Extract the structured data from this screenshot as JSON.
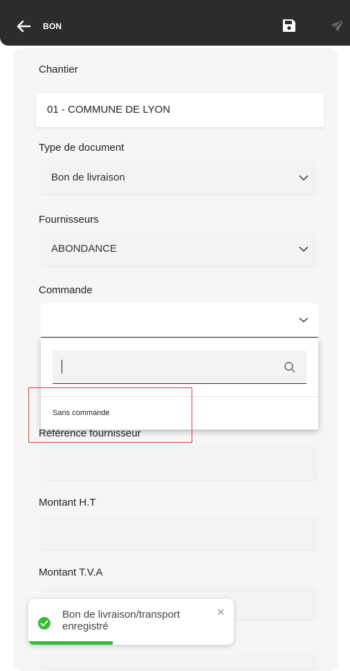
{
  "header": {
    "title": "BON",
    "icons": {
      "back": "arrow-left-icon",
      "save": "save-icon",
      "send": "send-icon"
    }
  },
  "form": {
    "chantier_label": "Chantier",
    "chantier_value": "01 - COMMUNE DE LYON",
    "type_label": "Type de document",
    "type_value": "Bon de livraison",
    "fournisseurs_label": "Fournisseurs",
    "fournisseurs_value": "ABONDANCE",
    "commande_label": "Commande",
    "commande_value": "",
    "ref_label": "Référence fournisseur",
    "montant_ht_label": "Montant H.T",
    "montant_tva_label": "Montant T.V.A"
  },
  "dropdown": {
    "search_value": "",
    "option_1": "Sans commande"
  },
  "toast": {
    "message": "Bon de livraison/transport enregistré",
    "close": "✕",
    "progress": 0.41,
    "accent": "#2fbf2f"
  },
  "colors": {
    "header_bg": "#2c2c2c",
    "highlight": "#e53935"
  }
}
